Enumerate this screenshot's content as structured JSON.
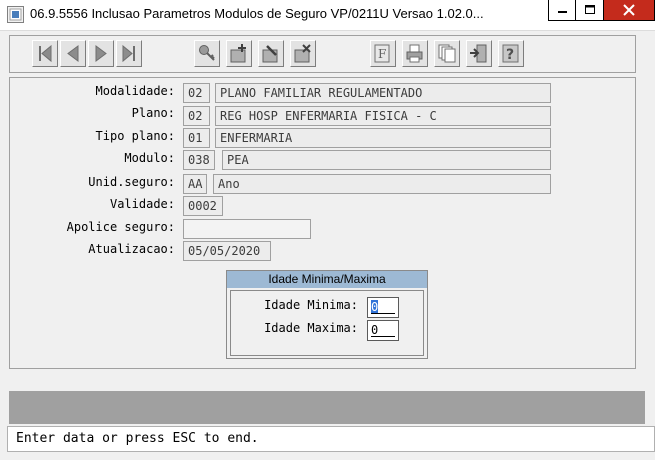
{
  "window": {
    "title": "06.9.5556  Inclusao  Parametros Modulos de Seguro VP/0211U Versao 1.02.0...",
    "close_color": "#c42b1c"
  },
  "toolbar": {
    "buttons": [
      {
        "icon": "first-record-icon"
      },
      {
        "icon": "previous-record-icon"
      },
      {
        "icon": "next-record-icon"
      },
      {
        "icon": "last-record-icon"
      },
      {
        "icon": "search-key-icon"
      },
      {
        "icon": "add-record-icon"
      },
      {
        "icon": "edit-record-icon"
      },
      {
        "icon": "delete-record-icon"
      },
      {
        "icon": "filter-icon"
      },
      {
        "icon": "print-icon"
      },
      {
        "icon": "copy-pages-icon"
      },
      {
        "icon": "exit-door-icon"
      },
      {
        "icon": "help-icon"
      }
    ]
  },
  "form": {
    "modalidade": {
      "label": "Modalidade:",
      "code": "02",
      "desc": "PLANO FAMILIAR REGULAMENTADO"
    },
    "plano": {
      "label": "Plano:",
      "code": "02",
      "desc": "REG HOSP ENFERMARIA FISICA - C"
    },
    "tipo_plano": {
      "label": "Tipo plano:",
      "code": "01",
      "desc": "ENFERMARIA"
    },
    "modulo": {
      "label": "Modulo:",
      "code": "038",
      "desc": "PEA"
    },
    "unid_seguro": {
      "label": "Unid.seguro:",
      "code": "AA",
      "desc": "Ano"
    },
    "validade": {
      "label": "Validade:",
      "value": "0002"
    },
    "apolice": {
      "label": "Apolice seguro:",
      "value": ""
    },
    "atualizacao": {
      "label": "Atualizacao:",
      "value": "05/05/2020"
    }
  },
  "age_group": {
    "title": "Idade Minima/Maxima",
    "min_label": "Idade Minima:",
    "min_value": "0",
    "max_label": "Idade Maxima:",
    "max_value": "0"
  },
  "status": {
    "message": "Enter data or press ESC to end."
  }
}
